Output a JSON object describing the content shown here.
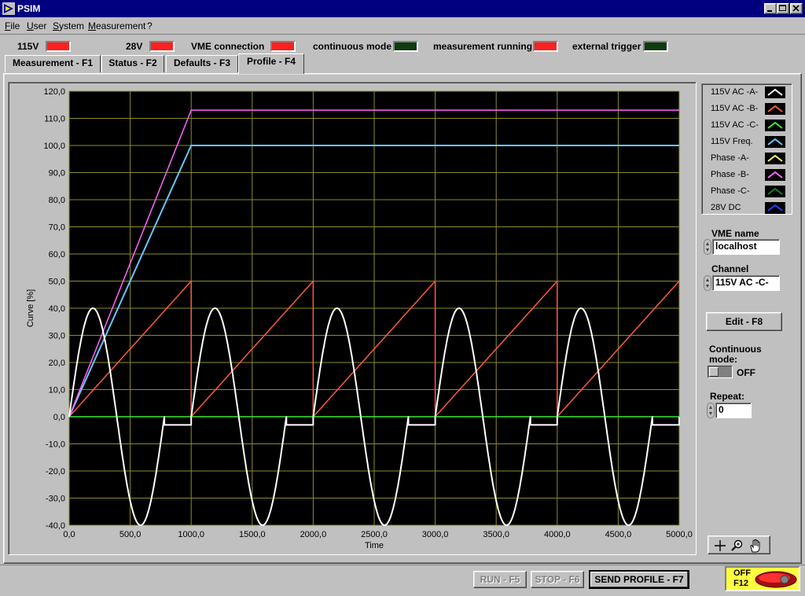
{
  "window": {
    "title": "PSIM"
  },
  "menu": [
    "File",
    "User",
    "System",
    "Measurement",
    "?"
  ],
  "status": {
    "items": [
      {
        "label": "115V",
        "state": "red"
      },
      {
        "label": "28V",
        "state": "red"
      },
      {
        "label": "VME connection",
        "state": "red"
      },
      {
        "label": "continuous mode",
        "state": "green"
      },
      {
        "label": "measurement running",
        "state": "red"
      },
      {
        "label": "external trigger",
        "state": "green"
      }
    ]
  },
  "tabs": [
    "Measurement - F1",
    "Status - F2",
    "Defaults - F3",
    "Profile - F4"
  ],
  "active_tab": 3,
  "legend": [
    {
      "label": "115V AC -A-",
      "color": "#ffffff"
    },
    {
      "label": "115V AC -B-",
      "color": "#ff5a3c"
    },
    {
      "label": "115V AC -C-",
      "color": "#33ee33"
    },
    {
      "label": "115V Freq.",
      "color": "#66c8ff"
    },
    {
      "label": "Phase -A-",
      "color": "#ffff66"
    },
    {
      "label": "Phase -B-",
      "color": "#ff66ff"
    },
    {
      "label": "Phase -C-",
      "color": "#0e8030"
    },
    {
      "label": "28V DC",
      "color": "#2a40ff"
    }
  ],
  "controls": {
    "vme_name_label": "VME name",
    "vme_name_value": "localhost",
    "channel_label": "Channel",
    "channel_value": "115V AC -C-",
    "edit_button": "Edit - F8",
    "continuous_label_1": "Continuous",
    "continuous_label_2": "mode:",
    "continuous_state": "OFF",
    "repeat_label": "Repeat:",
    "repeat_value": "0"
  },
  "buttons": {
    "run": "RUN - F5",
    "stop": "STOP - F6",
    "send": "SEND PROFILE - F7",
    "off_1": "OFF",
    "off_2": "F12"
  },
  "chart_data": {
    "type": "line",
    "ylabel": "Curve [%]",
    "xlabel": "Time",
    "xlim": [
      0,
      5000
    ],
    "ylim": [
      -40,
      120
    ],
    "x_ticks": [
      "0,0",
      "500,0",
      "1000,0",
      "1500,0",
      "2000,0",
      "2500,0",
      "3000,0",
      "3500,0",
      "4000,0",
      "4500,0",
      "5000,0"
    ],
    "y_ticks": [
      "120,0",
      "110,0",
      "100,0",
      "90,0",
      "80,0",
      "70,0",
      "60,0",
      "50,0",
      "40,0",
      "30,0",
      "20,0",
      "10,0",
      "0,0",
      "-10,0",
      "-20,0",
      "-30,0",
      "-40,0"
    ],
    "grid": true,
    "series": [
      {
        "color": "#ffffff",
        "kind": "sine",
        "amplitude": 40,
        "period": 1000,
        "sine_end": 780,
        "flat_value": -3
      },
      {
        "color": "#ff5a3c",
        "kind": "sawtooth",
        "peak": 50,
        "period": 1000
      },
      {
        "color": "#33ee33",
        "kind": "points",
        "points": [
          [
            0,
            0
          ],
          [
            5000,
            0
          ]
        ]
      },
      {
        "color": "#66c8ff",
        "kind": "points",
        "points": [
          [
            0,
            0
          ],
          [
            1000,
            100
          ],
          [
            5000,
            100
          ]
        ]
      },
      {
        "color": "#ff66ff",
        "kind": "points",
        "points": [
          [
            0,
            0
          ],
          [
            1000,
            113
          ],
          [
            5000,
            113
          ]
        ]
      }
    ]
  }
}
